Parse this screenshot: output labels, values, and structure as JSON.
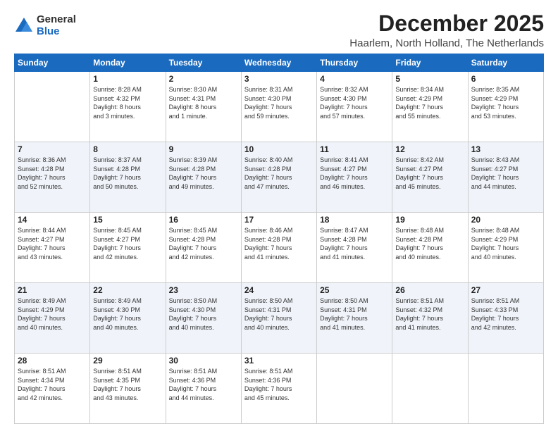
{
  "logo": {
    "general": "General",
    "blue": "Blue"
  },
  "title": "December 2025",
  "subtitle": "Haarlem, North Holland, The Netherlands",
  "days_of_week": [
    "Sunday",
    "Monday",
    "Tuesday",
    "Wednesday",
    "Thursday",
    "Friday",
    "Saturday"
  ],
  "weeks": [
    [
      {
        "day": "",
        "info": ""
      },
      {
        "day": "1",
        "info": "Sunrise: 8:28 AM\nSunset: 4:32 PM\nDaylight: 8 hours\nand 3 minutes."
      },
      {
        "day": "2",
        "info": "Sunrise: 8:30 AM\nSunset: 4:31 PM\nDaylight: 8 hours\nand 1 minute."
      },
      {
        "day": "3",
        "info": "Sunrise: 8:31 AM\nSunset: 4:30 PM\nDaylight: 7 hours\nand 59 minutes."
      },
      {
        "day": "4",
        "info": "Sunrise: 8:32 AM\nSunset: 4:30 PM\nDaylight: 7 hours\nand 57 minutes."
      },
      {
        "day": "5",
        "info": "Sunrise: 8:34 AM\nSunset: 4:29 PM\nDaylight: 7 hours\nand 55 minutes."
      },
      {
        "day": "6",
        "info": "Sunrise: 8:35 AM\nSunset: 4:29 PM\nDaylight: 7 hours\nand 53 minutes."
      }
    ],
    [
      {
        "day": "7",
        "info": "Sunrise: 8:36 AM\nSunset: 4:28 PM\nDaylight: 7 hours\nand 52 minutes."
      },
      {
        "day": "8",
        "info": "Sunrise: 8:37 AM\nSunset: 4:28 PM\nDaylight: 7 hours\nand 50 minutes."
      },
      {
        "day": "9",
        "info": "Sunrise: 8:39 AM\nSunset: 4:28 PM\nDaylight: 7 hours\nand 49 minutes."
      },
      {
        "day": "10",
        "info": "Sunrise: 8:40 AM\nSunset: 4:28 PM\nDaylight: 7 hours\nand 47 minutes."
      },
      {
        "day": "11",
        "info": "Sunrise: 8:41 AM\nSunset: 4:27 PM\nDaylight: 7 hours\nand 46 minutes."
      },
      {
        "day": "12",
        "info": "Sunrise: 8:42 AM\nSunset: 4:27 PM\nDaylight: 7 hours\nand 45 minutes."
      },
      {
        "day": "13",
        "info": "Sunrise: 8:43 AM\nSunset: 4:27 PM\nDaylight: 7 hours\nand 44 minutes."
      }
    ],
    [
      {
        "day": "14",
        "info": "Sunrise: 8:44 AM\nSunset: 4:27 PM\nDaylight: 7 hours\nand 43 minutes."
      },
      {
        "day": "15",
        "info": "Sunrise: 8:45 AM\nSunset: 4:27 PM\nDaylight: 7 hours\nand 42 minutes."
      },
      {
        "day": "16",
        "info": "Sunrise: 8:45 AM\nSunset: 4:28 PM\nDaylight: 7 hours\nand 42 minutes."
      },
      {
        "day": "17",
        "info": "Sunrise: 8:46 AM\nSunset: 4:28 PM\nDaylight: 7 hours\nand 41 minutes."
      },
      {
        "day": "18",
        "info": "Sunrise: 8:47 AM\nSunset: 4:28 PM\nDaylight: 7 hours\nand 41 minutes."
      },
      {
        "day": "19",
        "info": "Sunrise: 8:48 AM\nSunset: 4:28 PM\nDaylight: 7 hours\nand 40 minutes."
      },
      {
        "day": "20",
        "info": "Sunrise: 8:48 AM\nSunset: 4:29 PM\nDaylight: 7 hours\nand 40 minutes."
      }
    ],
    [
      {
        "day": "21",
        "info": "Sunrise: 8:49 AM\nSunset: 4:29 PM\nDaylight: 7 hours\nand 40 minutes."
      },
      {
        "day": "22",
        "info": "Sunrise: 8:49 AM\nSunset: 4:30 PM\nDaylight: 7 hours\nand 40 minutes."
      },
      {
        "day": "23",
        "info": "Sunrise: 8:50 AM\nSunset: 4:30 PM\nDaylight: 7 hours\nand 40 minutes."
      },
      {
        "day": "24",
        "info": "Sunrise: 8:50 AM\nSunset: 4:31 PM\nDaylight: 7 hours\nand 40 minutes."
      },
      {
        "day": "25",
        "info": "Sunrise: 8:50 AM\nSunset: 4:31 PM\nDaylight: 7 hours\nand 41 minutes."
      },
      {
        "day": "26",
        "info": "Sunrise: 8:51 AM\nSunset: 4:32 PM\nDaylight: 7 hours\nand 41 minutes."
      },
      {
        "day": "27",
        "info": "Sunrise: 8:51 AM\nSunset: 4:33 PM\nDaylight: 7 hours\nand 42 minutes."
      }
    ],
    [
      {
        "day": "28",
        "info": "Sunrise: 8:51 AM\nSunset: 4:34 PM\nDaylight: 7 hours\nand 42 minutes."
      },
      {
        "day": "29",
        "info": "Sunrise: 8:51 AM\nSunset: 4:35 PM\nDaylight: 7 hours\nand 43 minutes."
      },
      {
        "day": "30",
        "info": "Sunrise: 8:51 AM\nSunset: 4:36 PM\nDaylight: 7 hours\nand 44 minutes."
      },
      {
        "day": "31",
        "info": "Sunrise: 8:51 AM\nSunset: 4:36 PM\nDaylight: 7 hours\nand 45 minutes."
      },
      {
        "day": "",
        "info": ""
      },
      {
        "day": "",
        "info": ""
      },
      {
        "day": "",
        "info": ""
      }
    ]
  ]
}
